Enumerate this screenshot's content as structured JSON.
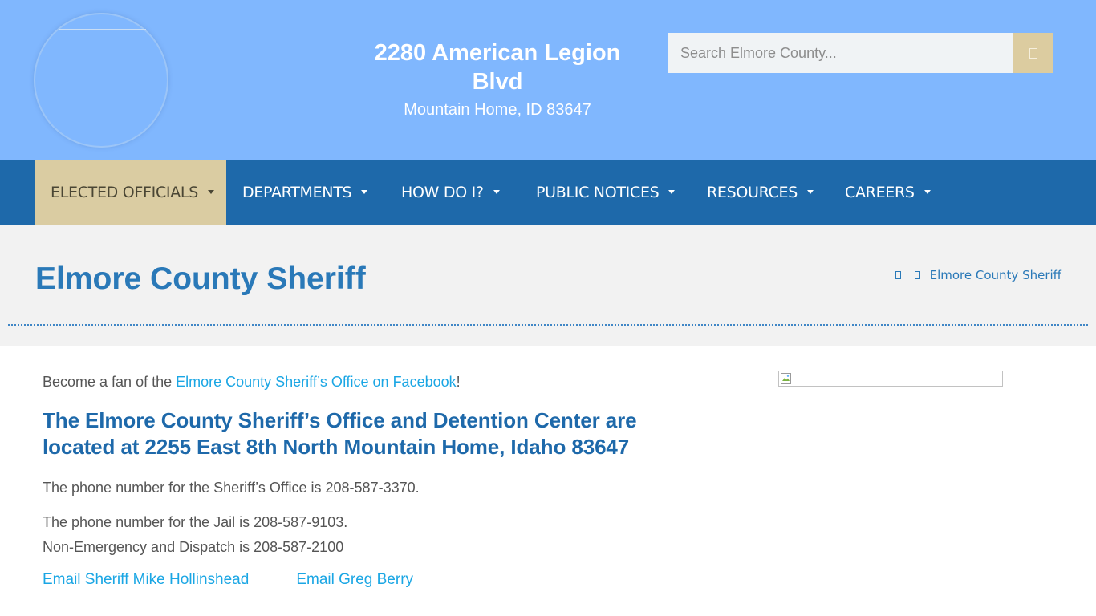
{
  "header": {
    "address_line1": "2280 American Legion Blvd",
    "address_line2": "Mountain Home, ID 83647",
    "logo_icon": "county-seal-icon",
    "search": {
      "placeholder": "Search Elmore County...",
      "value": "",
      "button_icon": "search-icon"
    }
  },
  "nav": {
    "items": [
      {
        "label": "ELECTED OFFICIALS",
        "active": true
      },
      {
        "label": "DEPARTMENTS"
      },
      {
        "label": "HOW DO I?"
      },
      {
        "label": "PUBLIC NOTICES"
      },
      {
        "label": "RESOURCES"
      },
      {
        "label": "CAREERS"
      }
    ]
  },
  "page": {
    "title": "Elmore County Sheriff",
    "breadcrumb": {
      "home_icon": "home-icon",
      "current": "Elmore County Sheriff"
    }
  },
  "content": {
    "fan_prefix": "Become a fan of the ",
    "fan_link": "Elmore County Sheriff’s Office on Facebook",
    "fan_suffix": "!",
    "heading": "The Elmore County Sheriff’s Office and Detention Center are located at 2255 East 8th North Mountain Home, Idaho 83647",
    "office_phone": "The phone number for the Sheriff’s Office is 208-587-3370.",
    "jail_phone": "The phone number for the Jail is 208-587-9103.",
    "dispatch_phone": "Non-Emergency and Dispatch is 208-587-2100",
    "email_sheriff": "Email Sheriff Mike Hollinshead",
    "email_berry": "Email Greg Berry"
  },
  "colors": {
    "header_bg": "#80b7fe",
    "nav_bg": "#1e69aa",
    "nav_active_bg": "#dacca2",
    "title_color": "#2a79b8",
    "link_color": "#1aa6e4"
  }
}
